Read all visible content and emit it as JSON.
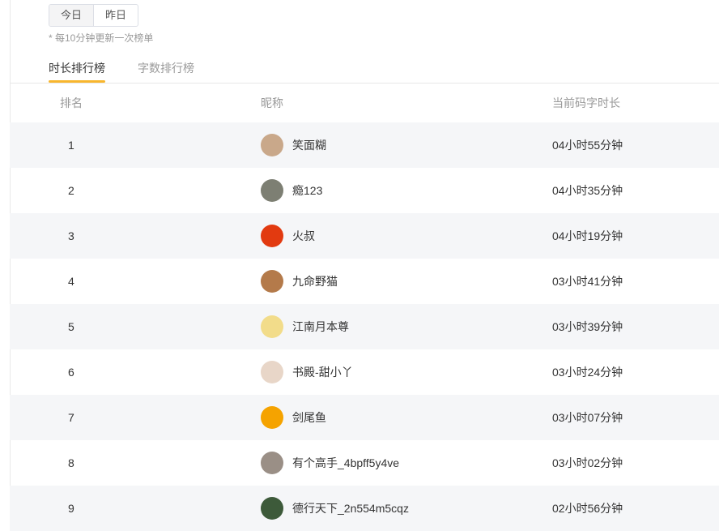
{
  "filters": {
    "today": "今日",
    "yesterday": "昨日"
  },
  "note": "* 每10分钟更新一次榜单",
  "tabs": [
    "时长排行榜",
    "字数排行榜"
  ],
  "columns": {
    "rank": "排名",
    "nickname": "昵称",
    "duration": "当前码字时长"
  },
  "rows": [
    {
      "rank": "1",
      "name": "笑面糊",
      "time": "04小时55分钟",
      "avatar": "#c9a88a"
    },
    {
      "rank": "2",
      "name": "瘾123",
      "time": "04小时35分钟",
      "avatar": "#7d7f73"
    },
    {
      "rank": "3",
      "name": "火叔",
      "time": "04小时19分钟",
      "avatar": "#e23a10"
    },
    {
      "rank": "4",
      "name": "九命野猫",
      "time": "03小时41分钟",
      "avatar": "#b47a4a"
    },
    {
      "rank": "5",
      "name": "江南月本尊",
      "time": "03小时39分钟",
      "avatar": "#f2dc8a"
    },
    {
      "rank": "6",
      "name": "书殿-甜小丫",
      "time": "03小时24分钟",
      "avatar": "#e8d6c8"
    },
    {
      "rank": "7",
      "name": "剑尾鱼",
      "time": "03小时07分钟",
      "avatar": "#f5a300"
    },
    {
      "rank": "8",
      "name": "有个高手_4bpff5y4ve",
      "time": "03小时02分钟",
      "avatar": "#9a8f86"
    },
    {
      "rank": "9",
      "name": "德行天下_2n554m5cqz",
      "time": "02小时56分钟",
      "avatar": "#3d5a3a"
    }
  ]
}
